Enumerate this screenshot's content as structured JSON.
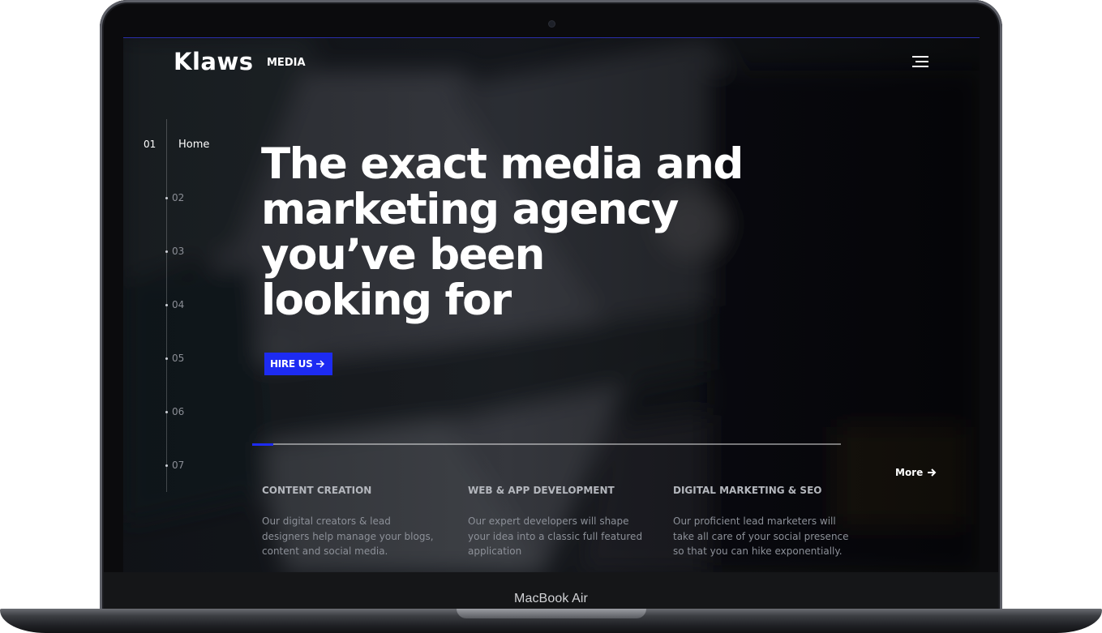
{
  "device": {
    "label": "MacBook Air"
  },
  "header": {
    "logo": "Klaws",
    "logo_sub": "MEDIA"
  },
  "nav": {
    "active": {
      "number": "01",
      "label": "Home"
    },
    "items": [
      "02",
      "03",
      "04",
      "05",
      "06",
      "07"
    ]
  },
  "hero": {
    "headline_lines": [
      "The exact media and",
      "marketing agency",
      "you’ve been",
      "looking for"
    ],
    "cta_label": "HIRE US"
  },
  "slider": {
    "progress": 0.036
  },
  "more_label": "More",
  "services": [
    {
      "title": "CONTENT CREATION",
      "text": [
        "Our digital creators & lead",
        "designers help manage your blogs,",
        "content and social media."
      ]
    },
    {
      "title": "WEB & APP DEVELOPMENT",
      "text": [
        "Our expert developers will shape",
        "your idea into a classic full featured",
        "application"
      ]
    },
    {
      "title": "DIGITAL MARKETING & SEO",
      "text": [
        "Our proficient lead marketers will",
        "take all care of your social presence",
        "so that you can hike exponentially."
      ]
    }
  ],
  "colors": {
    "accent": "#1d2bf2",
    "text": "#ffffff"
  },
  "icons": {
    "menu": "hamburger-icon",
    "cta": "arrow-right-icon",
    "more": "arrow-right-icon"
  }
}
